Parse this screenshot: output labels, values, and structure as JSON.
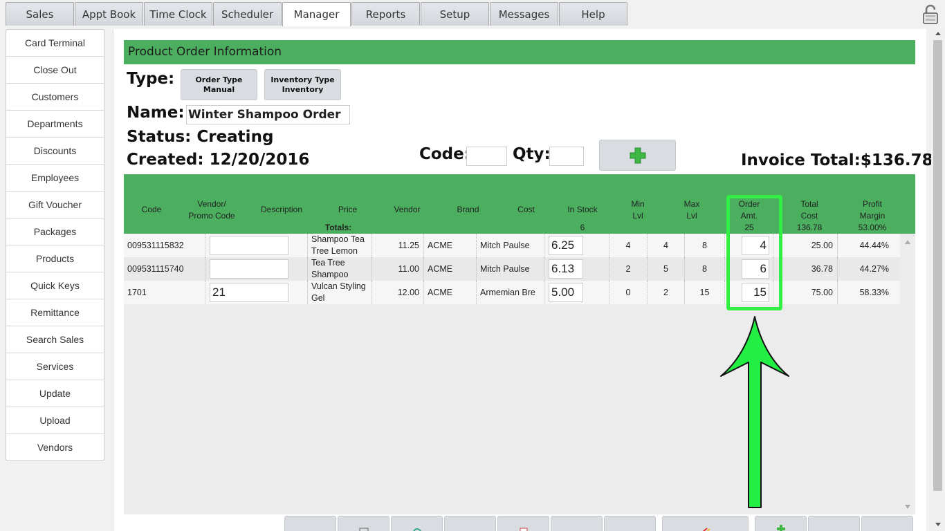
{
  "tabs": [
    "Sales",
    "Appt Book",
    "Time Clock",
    "Scheduler",
    "Manager",
    "Reports",
    "Setup",
    "Messages",
    "Help"
  ],
  "active_tab": "Manager",
  "sidebar": [
    "Card Terminal",
    "Close Out",
    "Customers",
    "Departments",
    "Discounts",
    "Employees",
    "Gift Voucher",
    "Packages",
    "Products",
    "Quick Keys",
    "Remittance",
    "Search Sales",
    "Services",
    "Update",
    "Upload",
    "Vendors"
  ],
  "panel": {
    "title": "Product Order Information",
    "type_label": "Type:",
    "order_type_btn": {
      "line1": "Order Type",
      "line2": "Manual"
    },
    "inventory_type_btn": {
      "line1": "Inventory Type",
      "line2": "Inventory"
    },
    "name_label": "Name:",
    "name_value": "Winter Shampoo Order",
    "status": "Status: Creating",
    "created": "Created: 12/20/2016",
    "code_label": "Code:",
    "qty_label": "Qty:",
    "invoice_total": "Invoice Total:$136.78"
  },
  "columns": {
    "code": "Code",
    "vendor_promo_1": "Vendor/",
    "vendor_promo_2": "Promo Code",
    "description": "Description",
    "price": "Price",
    "vendor": "Vendor",
    "brand": "Brand",
    "cost": "Cost",
    "in_stock": "In Stock",
    "min_1": "Min",
    "min_2": "Lvl",
    "max_1": "Max",
    "max_2": "Lvl",
    "order_1": "Order",
    "order_2": "Amt.",
    "total_1": "Total",
    "total_2": "Cost",
    "profit_1": "Profit",
    "profit_2": "Margin"
  },
  "totals": {
    "label": "Totals:",
    "in_stock": "6",
    "order_amt": "25",
    "total_cost": "136.78",
    "profit_margin": "53.00%"
  },
  "rows": [
    {
      "code": "009531115832",
      "promo": "",
      "desc1": "Shampoo Tea",
      "desc2": "Tree Lemon",
      "price": "11.25",
      "vendor": "ACME",
      "brand": "Mitch Paulse",
      "cost": "6.25",
      "in_stock": "4",
      "min": "4",
      "max": "8",
      "order": "4",
      "total": "25.00",
      "margin": "44.44%"
    },
    {
      "code": "009531115740",
      "promo": "",
      "desc1": "Tea Tree",
      "desc2": "Shampoo",
      "price": "11.00",
      "vendor": "ACME",
      "brand": "Mitch Paulse",
      "cost": "6.13",
      "in_stock": "2",
      "min": "5",
      "max": "8",
      "order": "6",
      "total": "36.78",
      "margin": "44.27%"
    },
    {
      "code": "1701",
      "promo": "21",
      "desc1": "Vulcan Styling",
      "desc2": "Gel",
      "price": "12.00",
      "vendor": "ACME",
      "brand": "Armemian Bre",
      "cost": "5.00",
      "in_stock": "0",
      "min": "2",
      "max": "15",
      "order": "15",
      "total": "75.00",
      "margin": "58.33%"
    }
  ],
  "colors": {
    "header_green": "#4caf5f",
    "highlight": "#33ee44",
    "arrow": "#22ee44"
  }
}
